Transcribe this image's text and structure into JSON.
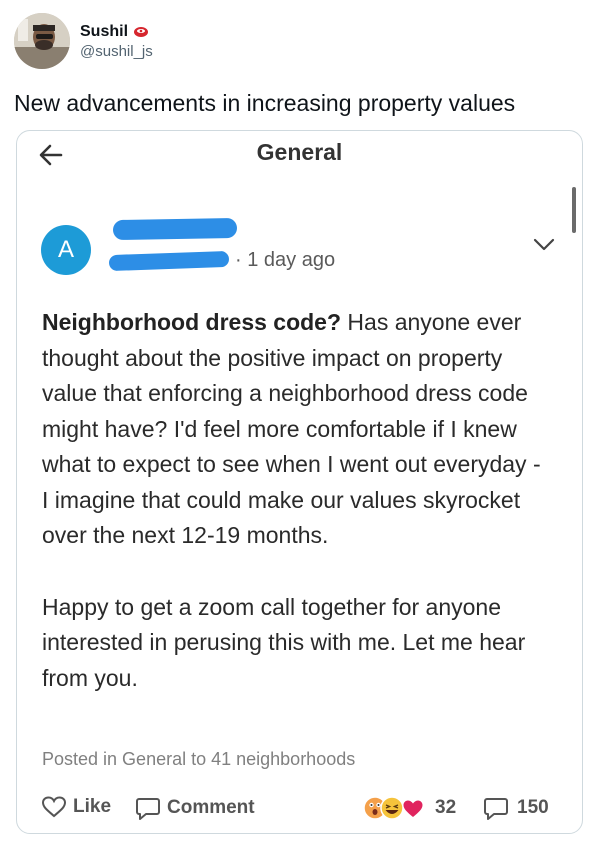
{
  "tweet": {
    "author_name": "Sushil",
    "author_handle": "@sushil_js",
    "text": "New advancements in increasing property values"
  },
  "card": {
    "title": "General",
    "post": {
      "avatar_letter": "A",
      "meta": "· 1 day ago",
      "title": "Neighborhood dress code?",
      "body_p1": " Has anyone ever thought about the positive impact on property value that enforcing a neighborhood dress code might have? I'd feel more comfortable if I knew what to expect to see when I went out everyday - I imagine that could make our values skyrocket over the next 12-19 months.",
      "body_p2": "Happy to get a zoom call together for anyone interested in perusing this with me. Let me hear from you.",
      "posted_in": "Posted in General to 41 neighborhoods"
    },
    "actions": {
      "like_label": "Like",
      "comment_label": "Comment",
      "reaction_count": "32",
      "comment_count": "150"
    }
  },
  "colors": {
    "avatar_blue": "#1d9bd7",
    "redaction_blue": "#2d8ee6",
    "heart_red": "#e0245e",
    "laugh_yellow": "#f5c33b",
    "wow_orange": "#f4a04a"
  },
  "icons": {
    "back": "back-arrow-icon",
    "expand": "chevron-down-icon",
    "like": "heart-outline-icon",
    "comment": "speech-bubble-icon",
    "verified": "badge-icon"
  }
}
